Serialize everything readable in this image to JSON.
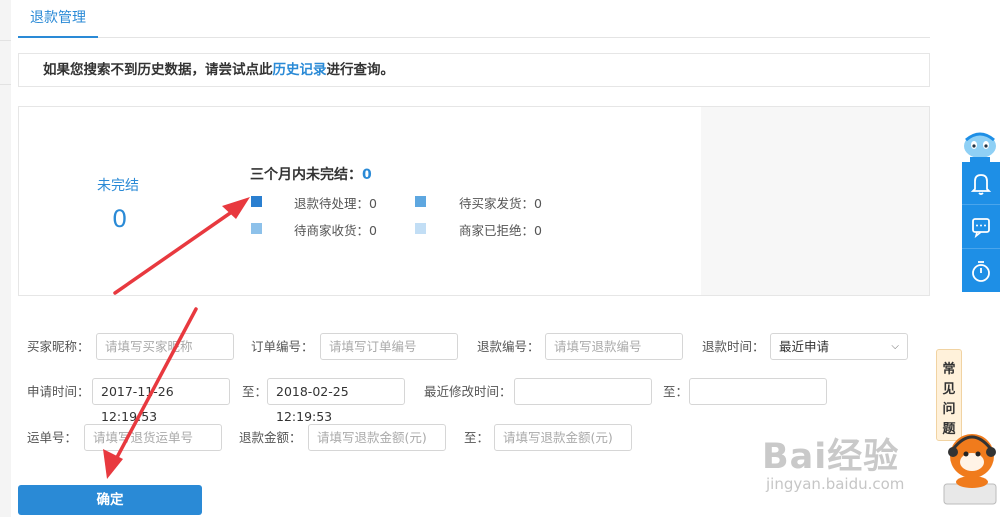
{
  "tab": {
    "label": "退款管理"
  },
  "notice": {
    "prefix": "如果您搜索不到历史数据，请尝试点此",
    "link": "历史记录",
    "suffix": "进行查询。"
  },
  "stats": {
    "unfinished_label": "未完结",
    "unfinished_value": "0",
    "three_month_label": "三个月内未完结：",
    "three_month_value": "0",
    "items": [
      {
        "label": "退款待处理：0",
        "color": "#2a7fd0"
      },
      {
        "label": "待买家发货：0",
        "color": "#5ea7e0"
      },
      {
        "label": "待商家收货：0",
        "color": "#8dc1ea"
      },
      {
        "label": "商家已拒绝：0",
        "color": "#c2def5"
      }
    ]
  },
  "filters": {
    "buyer_nick": {
      "label": "买家昵称：",
      "placeholder": "请填写买家昵称"
    },
    "order_no": {
      "label": "订单编号：",
      "placeholder": "请填写订单编号"
    },
    "refund_no": {
      "label": "退款编号：",
      "placeholder": "请填写退款编号"
    },
    "refund_time": {
      "label": "退款时间：",
      "value": "最近申请"
    },
    "apply_time": {
      "label": "申请时间：",
      "from": "2017-11-26 12:19:53",
      "to_label": "至：",
      "to": "2018-02-25 12:19:53"
    },
    "modify_time": {
      "label": "最近修改时间：",
      "to_label": "至："
    },
    "waybill": {
      "label": "运单号：",
      "placeholder": "请填写退货运单号"
    },
    "amount": {
      "label": "退款金额：",
      "placeholder": "请填写退款金额(元)",
      "to_label": "至：",
      "placeholder_to": "请填写退款金额(元)"
    }
  },
  "confirm_button": "确定",
  "faq": {
    "chars": [
      "常",
      "见",
      "问",
      "题"
    ]
  },
  "watermark": {
    "text": "Bai经验",
    "url": "jingyan.baidu.com"
  },
  "colors": {
    "accent": "#2a8ad6",
    "arrow": "#e8393f",
    "side_tool": "#1e8fe6"
  }
}
